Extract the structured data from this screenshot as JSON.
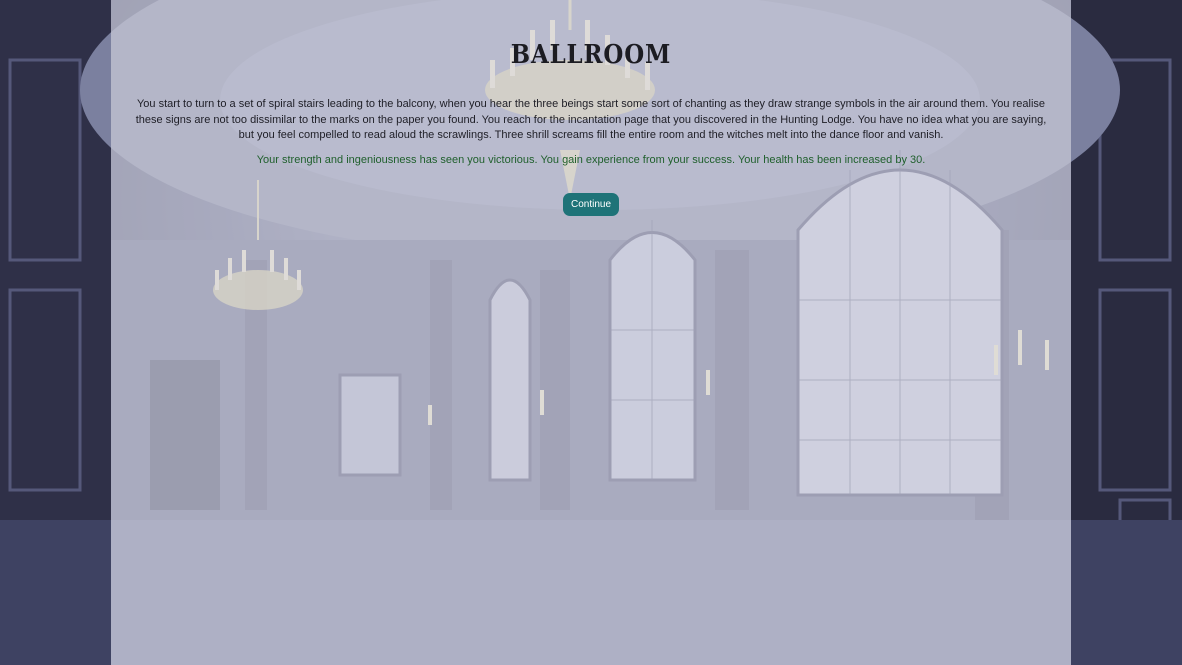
{
  "room": {
    "title": "BALLROOM"
  },
  "story": {
    "narration": "You start to turn to a set of spiral stairs leading to the balcony, when you hear the three beings start some sort of chanting as they draw strange symbols in the air around them. You realise these signs are not too dissimilar to the marks on the paper you found. You reach for the incantation page that you discovered in the Hunting Lodge. You have no idea what you are saying, but you feel compelled to read aloud the scrawlings. Three shrill screams fill the entire room and the witches melt into the dance floor and vanish.",
    "outcome": "Your strength and ingeniousness has seen you victorious. You gain experience from your success. Your health has been increased by 30."
  },
  "actions": {
    "continue_label": "Continue"
  },
  "colors": {
    "panel_overlay": "#d6d6e2",
    "outcome_text": "#1f5f2c",
    "button_bg": "#1e7378"
  },
  "icons": {
    "chandelier": "chandelier-icon",
    "stained_glass": "stained-glass-window-icon"
  }
}
